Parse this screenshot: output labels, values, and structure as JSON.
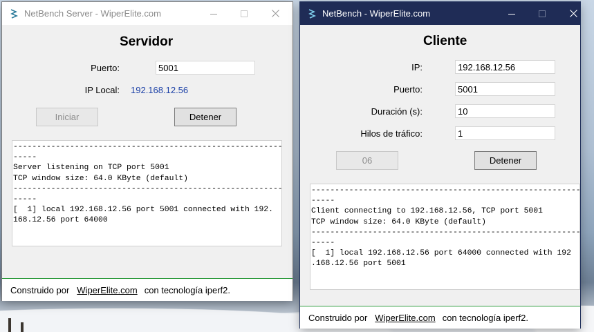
{
  "server_window": {
    "title": "NetBench Server - WiperElite.com",
    "heading": "Servidor",
    "port_label": "Puerto:",
    "port_value": "5001",
    "local_ip_label": "IP Local:",
    "local_ip_value": "192.168.12.56",
    "start_button": "Iniciar",
    "stop_button": "Detener",
    "log_lines": [
      "------------------------------------------------------------",
      "-----",
      "Server listening on TCP port 5001",
      "TCP window size: 64.0 KByte (default)",
      "------------------------------------------------------------",
      "-----",
      "[  1] local 192.168.12.56 port 5001 connected with 192.",
      "168.12.56 port 64000"
    ],
    "footer_prefix": "Construido por",
    "footer_link": "WiperElite.com",
    "footer_suffix": "con tecnología iperf2."
  },
  "client_window": {
    "title": "NetBench - WiperElite.com",
    "heading": "Cliente",
    "ip_label": "IP:",
    "ip_value": "192.168.12.56",
    "port_label": "Puerto:",
    "port_value": "5001",
    "duration_label": "Duración (s):",
    "duration_value": "10",
    "threads_label": "Hilos de tráfico:",
    "threads_value": "1",
    "countdown_button": "06",
    "stop_button": "Detener",
    "log_lines": [
      "------------------------------------------------------------",
      "-----",
      "Client connecting to 192.168.12.56, TCP port 5001",
      "TCP window size: 64.0 KByte (default)",
      "------------------------------------------------------------",
      "-----",
      "[  1] local 192.168.12.56 port 64000 connected with 192",
      ".168.12.56 port 5001"
    ],
    "footer_prefix": "Construido por",
    "footer_link": "WiperElite.com",
    "footer_suffix": "con tecnología iperf2."
  },
  "colors": {
    "client_titlebar": "#1f2c56",
    "ip_value_blue": "#1a3fa6",
    "footer_border": "#2e9b3d"
  },
  "icons": [
    "app-icon",
    "minimize-icon",
    "maximize-icon",
    "close-icon"
  ]
}
